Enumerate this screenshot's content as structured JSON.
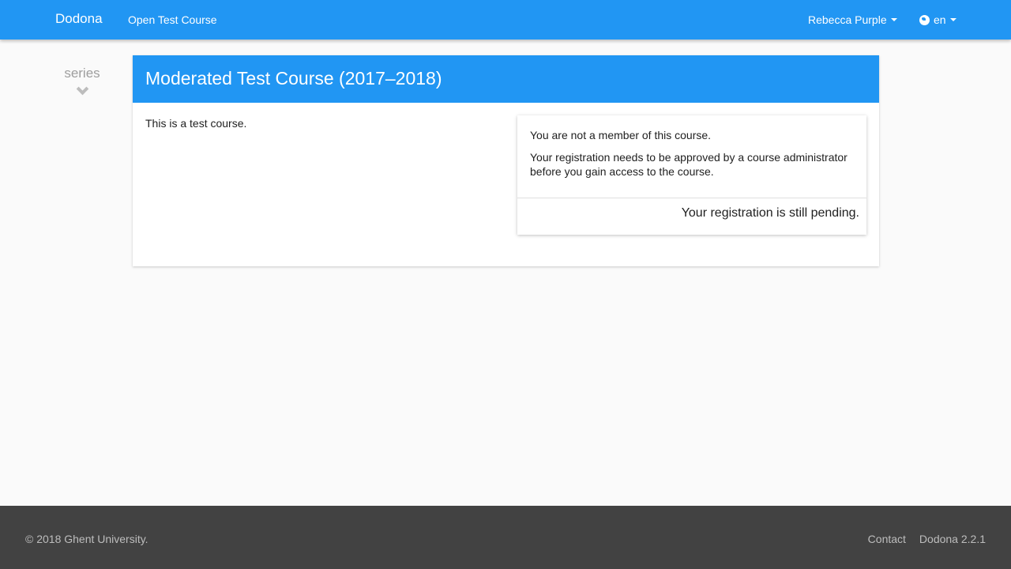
{
  "navbar": {
    "brand": "Dodona",
    "course_link": "Open Test Course",
    "user_name": "Rebecca Purple",
    "language": "en",
    "color": "#2196f3"
  },
  "sidebar": {
    "series_label": "series"
  },
  "course": {
    "title": "Moderated Test Course (2017–2018)",
    "description": "This is a test course."
  },
  "registration": {
    "not_member": "You are not a member of this course.",
    "approval_note": "Your registration needs to be approved by a course administrator before you gain access to the course.",
    "status": "Your registration is still pending."
  },
  "footer": {
    "copyright": "© 2018 Ghent University.",
    "contact": "Contact",
    "version": "Dodona 2.2.1"
  }
}
